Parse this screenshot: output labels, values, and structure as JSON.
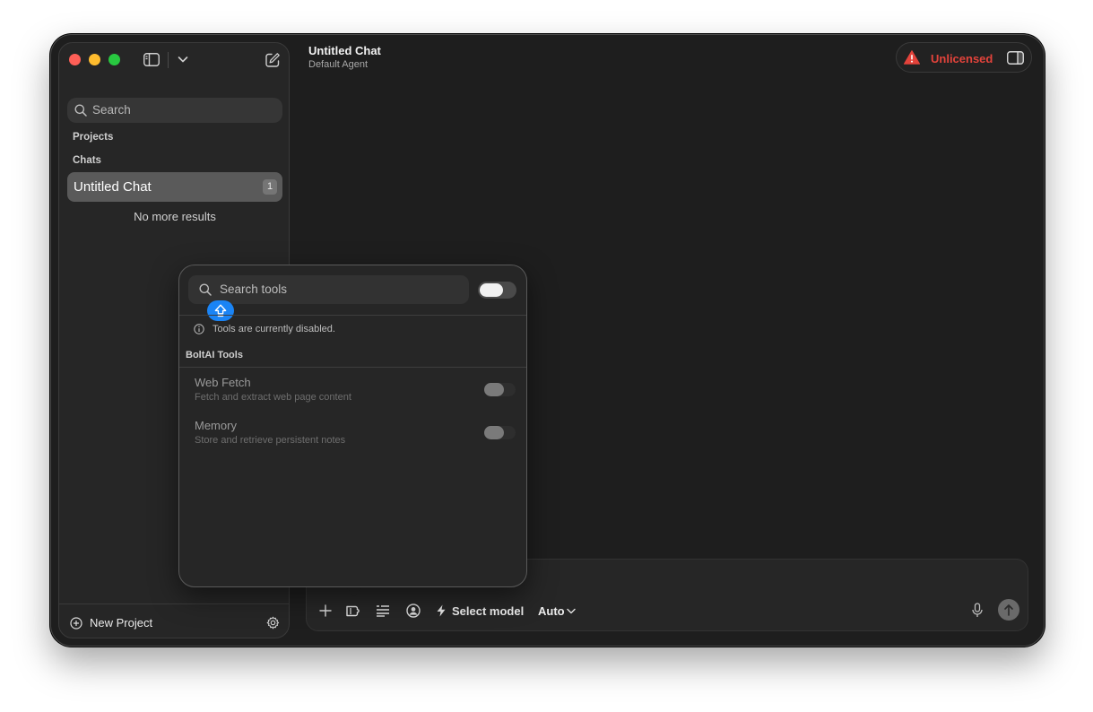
{
  "sidebar": {
    "search_placeholder": "Search",
    "sections": {
      "projects": "Projects",
      "chats": "Chats"
    },
    "chats": [
      {
        "title": "Untitled Chat",
        "badge": "1"
      }
    ],
    "no_more": "No more results",
    "new_project": "New Project"
  },
  "header": {
    "title": "Untitled Chat",
    "subtitle": "Default Agent",
    "license": "Unlicensed"
  },
  "composer": {
    "placeholder": "",
    "model_label": "Select model",
    "auto_label": "Auto"
  },
  "tools_popover": {
    "search_placeholder": "Search tools",
    "enabled": false,
    "notice": "Tools are currently disabled.",
    "group": "BoltAI Tools",
    "tools": [
      {
        "name": "Web Fetch",
        "description": "Fetch and extract web page content",
        "enabled": false
      },
      {
        "name": "Memory",
        "description": "Store and retrieve persistent notes",
        "enabled": false
      }
    ]
  },
  "colors": {
    "accent_blue": "#1a84f5",
    "warning_red": "#e3433b"
  }
}
